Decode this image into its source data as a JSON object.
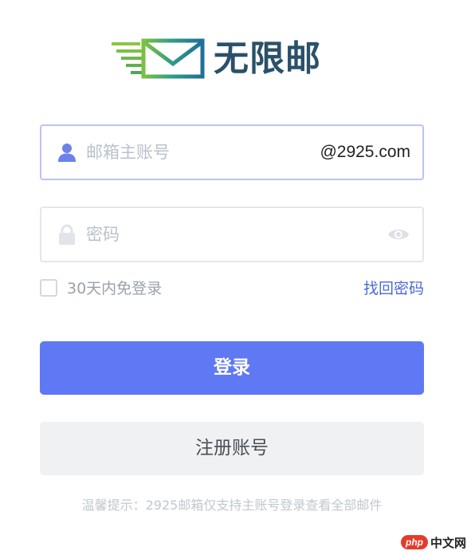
{
  "logo": {
    "text": "无限邮"
  },
  "account_field": {
    "placeholder": "邮箱主账号",
    "value": "",
    "suffix": "@2925.com",
    "icon": "user-icon"
  },
  "password_field": {
    "placeholder": "密码",
    "value": "",
    "icon": "lock-icon",
    "toggle_icon": "eye-icon"
  },
  "remember": {
    "label": "30天内免登录",
    "checked": false
  },
  "forgot_password": "找回密码",
  "login_button": "登录",
  "register_button": "注册账号",
  "tip": "温馨提示：2925邮箱仅支持主账号登录查看全部邮件",
  "watermark": {
    "badge": "php",
    "text": "中文网"
  },
  "colors": {
    "accent": "#5f78f3",
    "link": "#4a6bd6",
    "logo_text": "#2b5169"
  }
}
